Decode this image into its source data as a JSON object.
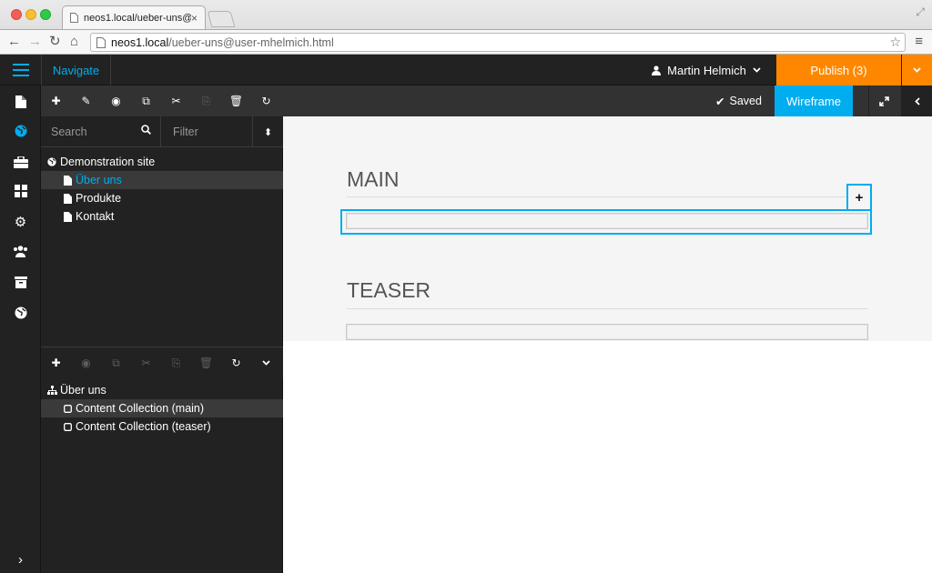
{
  "browser": {
    "tab_title": "neos1.local/ueber-uns@us",
    "tab_close": "×",
    "url_domain": "neos1.local",
    "url_path": "/ueber-uns@user-mhelmich.html"
  },
  "topbar": {
    "navigate_label": "Navigate",
    "user_name": "Martin Helmich",
    "publish_label": "Publish (3)"
  },
  "secondbar": {
    "saved_label": "Saved",
    "wireframe_label": "Wireframe"
  },
  "search": {
    "placeholder": "Search",
    "filter_placeholder": "Filter"
  },
  "page_tree": {
    "root": "Demonstration site",
    "items": [
      "Über uns",
      "Produkte",
      "Kontakt"
    ],
    "selected_index": 0
  },
  "content_tree": {
    "root": "Über uns",
    "items": [
      "Content Collection (main)",
      "Content Collection (teaser)"
    ],
    "selected_index": 0
  },
  "content": {
    "main_title": "MAIN",
    "teaser_title": "TEASER",
    "add_symbol": "+"
  },
  "colors": {
    "accent": "#00adee",
    "publish": "#ff8700",
    "panel_dark": "#222222",
    "toolbar_dark": "#323232"
  }
}
